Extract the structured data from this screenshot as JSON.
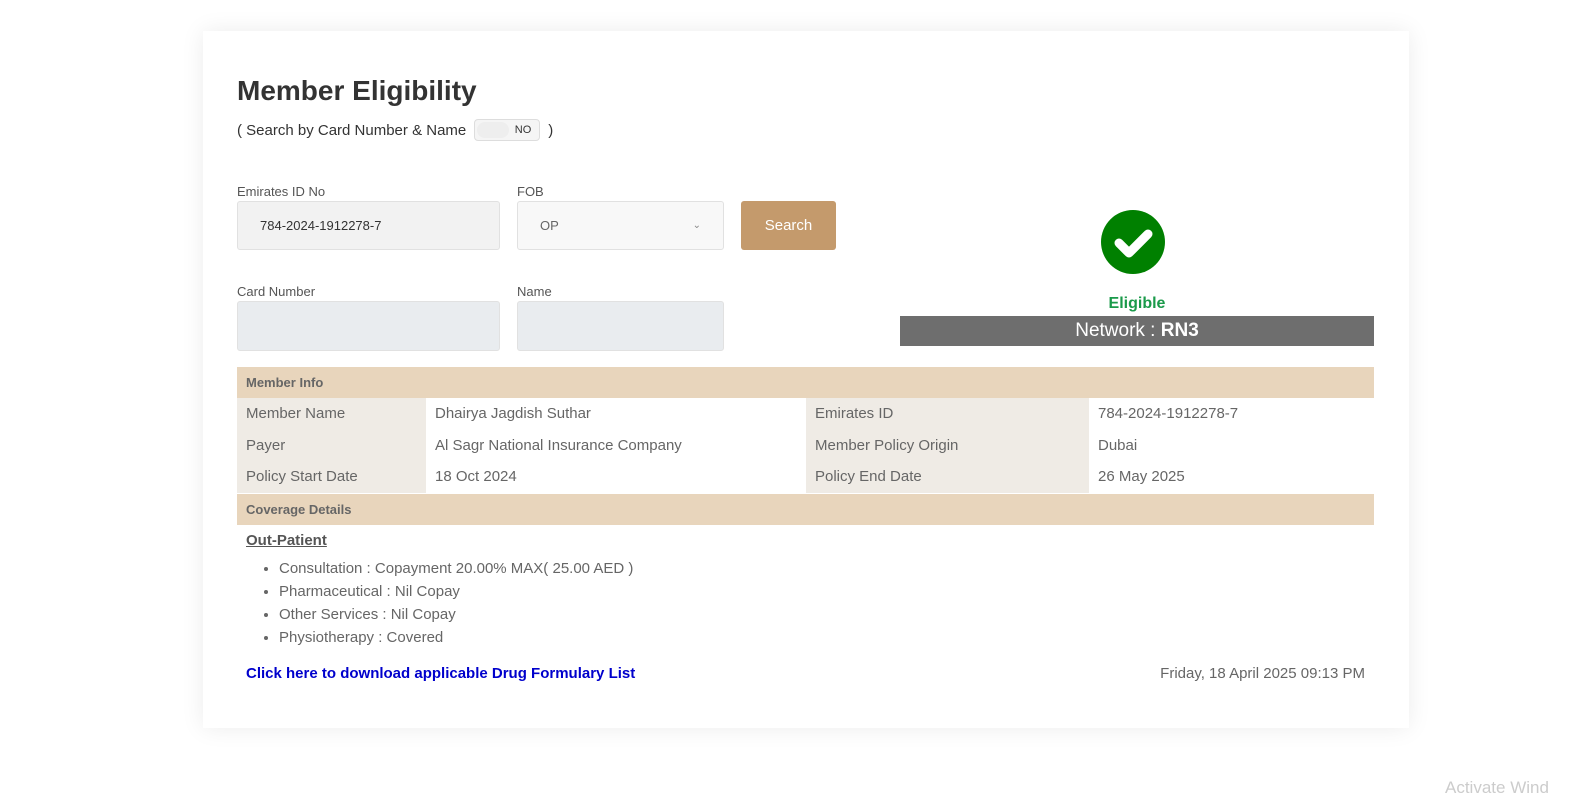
{
  "title": "Member Eligibility",
  "search_toggle": {
    "prefix": "( Search by Card Number & Name",
    "suffix": ")",
    "state": "NO"
  },
  "form": {
    "emirates_label": "Emirates ID No",
    "emirates_value": "784-2024-1912278-7",
    "fob_label": "FOB",
    "fob_value": "OP",
    "search": "Search",
    "card_label": "Card Number",
    "name_label": "Name"
  },
  "status": {
    "text": "Eligible",
    "network_label": "Network : ",
    "network": "RN3",
    "color": "#008000"
  },
  "member_info": {
    "header": "Member Info",
    "rows": [
      [
        "Member Name",
        "Dhairya Jagdish Suthar",
        "Emirates ID",
        "784-2024-1912278-7"
      ],
      [
        "Payer",
        "Al Sagr National Insurance Company",
        "Member Policy Origin",
        "Dubai"
      ],
      [
        "Policy Start Date",
        "18 Oct 2024",
        "Policy End Date",
        "26 May 2025"
      ]
    ]
  },
  "coverage": {
    "header": "Coverage Details",
    "category": "Out-Patient",
    "items": [
      "Consultation : Copayment 20.00% MAX( 25.00 AED )",
      "Pharmaceutical : Nil Copay",
      "Other Services : Nil Copay",
      "Physiotherapy : Covered"
    ]
  },
  "download_link": "Click here to download applicable Drug Formulary List",
  "datetime": "Friday, 18 April 2025 09:13 PM",
  "watermark": "Activate Wind"
}
